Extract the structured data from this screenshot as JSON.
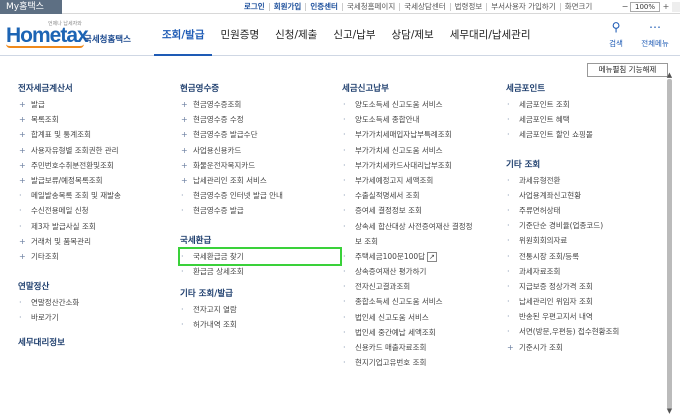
{
  "topbar": {
    "my_tab": "My홈택스",
    "links": [
      "로그인",
      "회원가입",
      "인증센터",
      "국세청홈페이지",
      "국세상담센터",
      "법령정보",
      "부서사용자 가입하기",
      "화면크기"
    ],
    "zoom": "100%"
  },
  "header": {
    "logo_main": "Hometax",
    "logo_kor": "국세청홈택스",
    "logo_slogan": "언제나 납세자와",
    "nav": [
      "조회/발급",
      "민원증명",
      "신청/제출",
      "신고/납부",
      "상담/제보",
      "세무대리/납세관리"
    ],
    "search_label": "검색",
    "allmenu_label": "전체메뉴"
  },
  "toolbar": {
    "menu_tool": "메뉴펼침 기능해제"
  },
  "col1": {
    "title": "전자세금계산서",
    "items": [
      {
        "icon": "+",
        "label": "발급"
      },
      {
        "icon": "+",
        "label": "목록조회"
      },
      {
        "icon": "+",
        "label": "합계표 및 통계조회"
      },
      {
        "icon": "+",
        "label": "사용자유형별 조회권한 관리"
      },
      {
        "icon": "+",
        "label": "주민번호수취분전환및조회"
      },
      {
        "icon": "+",
        "label": "발급보류/예정목록조회"
      },
      {
        "icon": "·",
        "label": "메일발송목록 조회 및 재발송"
      },
      {
        "icon": "·",
        "label": "수신전용메일 신청"
      },
      {
        "icon": "·",
        "label": "제3자 발급사실 조회"
      },
      {
        "icon": "+",
        "label": "거래처 및 품목관리"
      },
      {
        "icon": "+",
        "label": "기타조회"
      }
    ],
    "title2": "연말정산",
    "items2": [
      {
        "icon": "·",
        "label": "연말정산간소화"
      },
      {
        "icon": "·",
        "label": "바로가기"
      }
    ],
    "title3": "세무대리정보"
  },
  "col2": {
    "title": "현금영수증",
    "items": [
      {
        "icon": "+",
        "label": "현금영수증조회"
      },
      {
        "icon": "+",
        "label": "현금영수증 수정"
      },
      {
        "icon": "+",
        "label": "현금영수증 발급수단"
      },
      {
        "icon": "+",
        "label": "사업용신용카드"
      },
      {
        "icon": "+",
        "label": "화물운전자복지카드"
      },
      {
        "icon": "+",
        "label": "납세관리인 조회 서비스"
      },
      {
        "icon": "·",
        "label": "현금영수증 인터넷 발급 안내"
      },
      {
        "icon": "·",
        "label": "현금영수증 발급"
      }
    ],
    "title2": "국세환급",
    "items2": [
      {
        "icon": "·",
        "label": "국세환급금 찾기"
      },
      {
        "icon": "·",
        "label": "환급금 상세조회"
      }
    ],
    "title3": "기타 조회/발급",
    "items3": [
      {
        "icon": "·",
        "label": "전자고지 열람"
      },
      {
        "icon": "·",
        "label": "허가내역 조회"
      }
    ]
  },
  "col3": {
    "title": "세금신고납부",
    "items": [
      {
        "icon": "·",
        "label": "양도소득세 신고도움 서비스"
      },
      {
        "icon": "·",
        "label": "양도소득세 종합안내"
      },
      {
        "icon": "·",
        "label": "부가가치세매입자납부특례조회"
      },
      {
        "icon": "·",
        "label": "부가가치세 신고도움 서비스"
      },
      {
        "icon": "·",
        "label": "부가가치세카드사대리납부조회"
      },
      {
        "icon": "·",
        "label": "부가세예정고지 세액조회"
      },
      {
        "icon": "·",
        "label": "수출실적명세서 조회"
      },
      {
        "icon": "·",
        "label": "증여세 결정정보 조회"
      },
      {
        "icon": "·",
        "label": "상속세 합산대상 사전증여재산 결정정"
      },
      {
        "icon": "",
        "label": "보 조회"
      },
      {
        "icon": "·",
        "label": "주택세금100문100답",
        "ext": "↗"
      },
      {
        "icon": "·",
        "label": "상속증여재산 평가하기"
      },
      {
        "icon": "·",
        "label": "전자신고결과조회"
      },
      {
        "icon": "·",
        "label": "종합소득세 신고도움 서비스"
      },
      {
        "icon": "·",
        "label": "법인세 신고도움 서비스"
      },
      {
        "icon": "·",
        "label": "법인세 중간예납 세액조회"
      },
      {
        "icon": "·",
        "label": "신용카드 매출자료조회"
      },
      {
        "icon": "·",
        "label": "현지기업고유번호 조회"
      }
    ]
  },
  "col4": {
    "title": "세금포인트",
    "items": [
      {
        "icon": "·",
        "label": "세금포인트 조회"
      },
      {
        "icon": "·",
        "label": "세금포인트 혜택"
      },
      {
        "icon": "·",
        "label": "세금포인트 할인 쇼핑몰"
      }
    ],
    "title2": "기타 조회",
    "items2": [
      {
        "icon": "·",
        "label": "과세유형전환"
      },
      {
        "icon": "·",
        "label": "사업용계좌신고현황"
      },
      {
        "icon": "·",
        "label": "주류면허상태"
      },
      {
        "icon": "·",
        "label": "기준단순 경비율(업종코드)"
      },
      {
        "icon": "·",
        "label": "위원회회의자료"
      },
      {
        "icon": "·",
        "label": "전통시장 조회/등록"
      },
      {
        "icon": "·",
        "label": "과세자료조회"
      },
      {
        "icon": "·",
        "label": "지급보증 정상가격 조회"
      },
      {
        "icon": "·",
        "label": "납세관리인 위임자 조회"
      },
      {
        "icon": "·",
        "label": "반송된 우편고지서 내역"
      },
      {
        "icon": "·",
        "label": "서면(방문,우편등) 접수현황조회"
      },
      {
        "icon": "+",
        "label": "기준시가 조회"
      }
    ]
  }
}
